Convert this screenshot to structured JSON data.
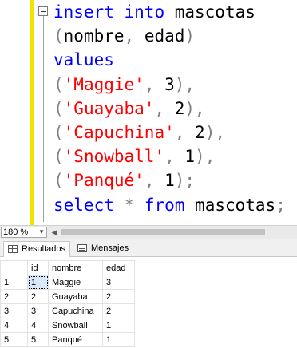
{
  "editor": {
    "lines": [
      [
        {
          "t": "insert",
          "c": "kw"
        },
        {
          "t": " ",
          "c": "plain"
        },
        {
          "t": "into",
          "c": "kw"
        },
        {
          "t": " mascotas",
          "c": "plain"
        }
      ],
      [
        {
          "t": "(",
          "c": "pun"
        },
        {
          "t": "nombre",
          "c": "plain"
        },
        {
          "t": ", ",
          "c": "pun"
        },
        {
          "t": "edad",
          "c": "plain"
        },
        {
          "t": ")",
          "c": "pun"
        }
      ],
      [
        {
          "t": "values",
          "c": "kw"
        }
      ],
      [
        {
          "t": "(",
          "c": "pun"
        },
        {
          "t": "'Maggie'",
          "c": "str"
        },
        {
          "t": ", ",
          "c": "pun"
        },
        {
          "t": "3",
          "c": "plain"
        },
        {
          "t": "),",
          "c": "pun"
        }
      ],
      [
        {
          "t": "(",
          "c": "pun"
        },
        {
          "t": "'Guayaba'",
          "c": "str"
        },
        {
          "t": ", ",
          "c": "pun"
        },
        {
          "t": "2",
          "c": "plain"
        },
        {
          "t": "),",
          "c": "pun"
        }
      ],
      [
        {
          "t": "(",
          "c": "pun"
        },
        {
          "t": "'Capuchina'",
          "c": "str"
        },
        {
          "t": ", ",
          "c": "pun"
        },
        {
          "t": "2",
          "c": "plain"
        },
        {
          "t": "),",
          "c": "pun"
        }
      ],
      [
        {
          "t": "(",
          "c": "pun"
        },
        {
          "t": "'Snowball'",
          "c": "str"
        },
        {
          "t": ", ",
          "c": "pun"
        },
        {
          "t": "1",
          "c": "plain"
        },
        {
          "t": "),",
          "c": "pun"
        }
      ],
      [
        {
          "t": "(",
          "c": "pun"
        },
        {
          "t": "'Panqué'",
          "c": "str"
        },
        {
          "t": ", ",
          "c": "pun"
        },
        {
          "t": "1",
          "c": "plain"
        },
        {
          "t": ");",
          "c": "pun"
        }
      ],
      [
        {
          "t": "select",
          "c": "kw"
        },
        {
          "t": " ",
          "c": "plain"
        },
        {
          "t": "*",
          "c": "pun"
        },
        {
          "t": " ",
          "c": "plain"
        },
        {
          "t": "from",
          "c": "kw"
        },
        {
          "t": " mascotas",
          "c": "plain"
        },
        {
          "t": ";",
          "c": "pun"
        }
      ]
    ],
    "colors": {
      "keyword": "#0000ff",
      "string": "#ff0000",
      "punctuation": "#808080",
      "change_bar": "#f3e300"
    }
  },
  "zoom": {
    "value": "180 %"
  },
  "tabs": {
    "results": "Resultados",
    "messages": "Mensajes"
  },
  "results": {
    "columns": [
      "id",
      "nombre",
      "edad"
    ],
    "rows": [
      {
        "num": "1",
        "cells": [
          "1",
          "Maggie",
          "3"
        ]
      },
      {
        "num": "2",
        "cells": [
          "2",
          "Guayaba",
          "2"
        ]
      },
      {
        "num": "3",
        "cells": [
          "3",
          "Capuchina",
          "2"
        ]
      },
      {
        "num": "4",
        "cells": [
          "4",
          "Snowball",
          "1"
        ]
      },
      {
        "num": "5",
        "cells": [
          "5",
          "Panqué",
          "1"
        ]
      }
    ]
  }
}
